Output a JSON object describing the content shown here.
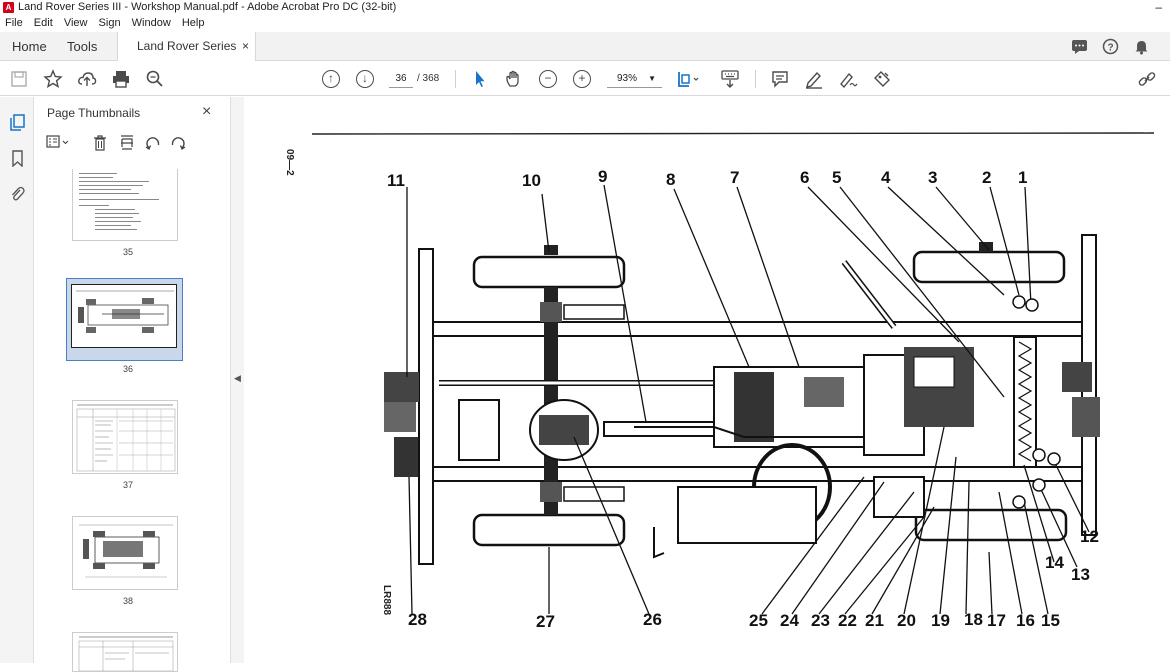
{
  "window": {
    "title": "Land Rover Series III - Workshop Manual.pdf - Adobe Acrobat Pro DC (32-bit)",
    "minimize": "–"
  },
  "menu": [
    "File",
    "Edit",
    "View",
    "Sign",
    "Window",
    "Help"
  ],
  "tabs": {
    "home": "Home",
    "tools": "Tools",
    "document": "Land Rover Series II...",
    "close": "×"
  },
  "toolbar": {
    "page_current": "36",
    "page_total": "/ 368",
    "zoom": "93%"
  },
  "panel": {
    "title": "Page Thumbnails",
    "close": "×"
  },
  "thumbnails": [
    {
      "label": "35"
    },
    {
      "label": "36"
    },
    {
      "label": "37"
    },
    {
      "label": "38"
    }
  ],
  "document": {
    "page_ref": "09—2",
    "figure_code": "LR888",
    "callouts_top": [
      "11",
      "10",
      "9",
      "8",
      "7",
      "6",
      "5",
      "4",
      "3",
      "2",
      "1"
    ],
    "callouts_right": [
      "12",
      "14",
      "13"
    ],
    "callouts_bottom": [
      "28",
      "27",
      "26",
      "25",
      "24",
      "23",
      "22",
      "21",
      "20",
      "19",
      "18",
      "17",
      "16",
      "15"
    ]
  },
  "colors": {
    "accent": "#4a7ec6",
    "adobe_red": "#d0021b"
  }
}
